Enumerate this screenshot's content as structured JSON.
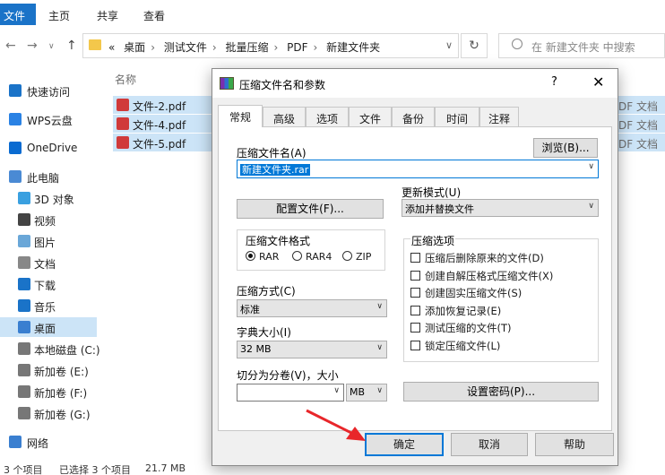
{
  "explorer": {
    "ribbon": {
      "file": "文件",
      "home": "主页",
      "share": "共享",
      "view": "查看"
    },
    "breadcrumb": [
      "«",
      "桌面",
      "测试文件",
      "批量压缩",
      "PDF",
      "新建文件夹"
    ],
    "search_placeholder": "在 新建文件夹 中搜索",
    "sidebar": [
      {
        "label": "快速访问",
        "icon": "star-icon",
        "color": "#1a73c8"
      },
      {
        "label": "WPS云盘",
        "icon": "cloud-icon",
        "color": "#2a82e4"
      },
      {
        "label": "OneDrive",
        "icon": "cloud-icon",
        "color": "#0a6bd1"
      },
      {
        "label": "此电脑",
        "icon": "computer-icon",
        "color": "#4a8ad4"
      },
      {
        "label": "3D 对象",
        "icon": "cube-icon",
        "color": "#3aa0e0"
      },
      {
        "label": "视频",
        "icon": "video-icon",
        "color": "#444"
      },
      {
        "label": "图片",
        "icon": "picture-icon",
        "color": "#6aa7d8"
      },
      {
        "label": "文档",
        "icon": "document-icon",
        "color": "#888"
      },
      {
        "label": "下载",
        "icon": "download-icon",
        "color": "#1a73c8"
      },
      {
        "label": "音乐",
        "icon": "music-icon",
        "color": "#1a73c8"
      },
      {
        "label": "桌面",
        "icon": "desktop-icon",
        "color": "#3a7fd0"
      },
      {
        "label": "本地磁盘 (C:)",
        "icon": "drive-icon",
        "color": "#777"
      },
      {
        "label": "新加卷 (E:)",
        "icon": "drive-icon",
        "color": "#777"
      },
      {
        "label": "新加卷 (F:)",
        "icon": "drive-icon",
        "color": "#777"
      },
      {
        "label": "新加卷 (G:)",
        "icon": "drive-icon",
        "color": "#777"
      },
      {
        "label": "网络",
        "icon": "network-icon",
        "color": "#3a7fd0"
      }
    ],
    "column_name": "名称",
    "files": [
      {
        "name": "文件-2.pdf",
        "type": "DF 文档"
      },
      {
        "name": "文件-4.pdf",
        "type": "DF 文档"
      },
      {
        "name": "文件-5.pdf",
        "type": "DF 文档"
      }
    ],
    "status": {
      "count": "3 个项目",
      "selected": "已选择 3 个项目",
      "size": "21.7 MB"
    }
  },
  "dialog": {
    "title": "压缩文件名和参数",
    "help": "?",
    "tabs": [
      "常规",
      "高级",
      "选项",
      "文件",
      "备份",
      "时间",
      "注释"
    ],
    "archive_name_label": "压缩文件名(A)",
    "browse_label": "浏览(B)...",
    "archive_name_value": "新建文件夹.rar",
    "update_mode_label": "更新模式(U)",
    "update_mode_value": "添加并替换文件",
    "profiles_label": "配置文件(F)...",
    "format_group": "压缩文件格式",
    "formats": [
      {
        "label": "RAR",
        "checked": true
      },
      {
        "label": "RAR4",
        "checked": false
      },
      {
        "label": "ZIP",
        "checked": false
      }
    ],
    "options_group": "压缩选项",
    "options": [
      "压缩后删除原来的文件(D)",
      "创建自解压格式压缩文件(X)",
      "创建固实压缩文件(S)",
      "添加恢复记录(E)",
      "测试压缩的文件(T)",
      "锁定压缩文件(L)"
    ],
    "method_label": "压缩方式(C)",
    "method_value": "标准",
    "dict_label": "字典大小(I)",
    "dict_value": "32 MB",
    "split_label": "切分为分卷(V)，大小",
    "split_value": "",
    "split_unit": "MB",
    "password_label": "设置密码(P)...",
    "ok": "确定",
    "cancel": "取消",
    "help_button": "帮助",
    "accent_color": "#0078d7",
    "annotation_color": "#e8262a"
  }
}
